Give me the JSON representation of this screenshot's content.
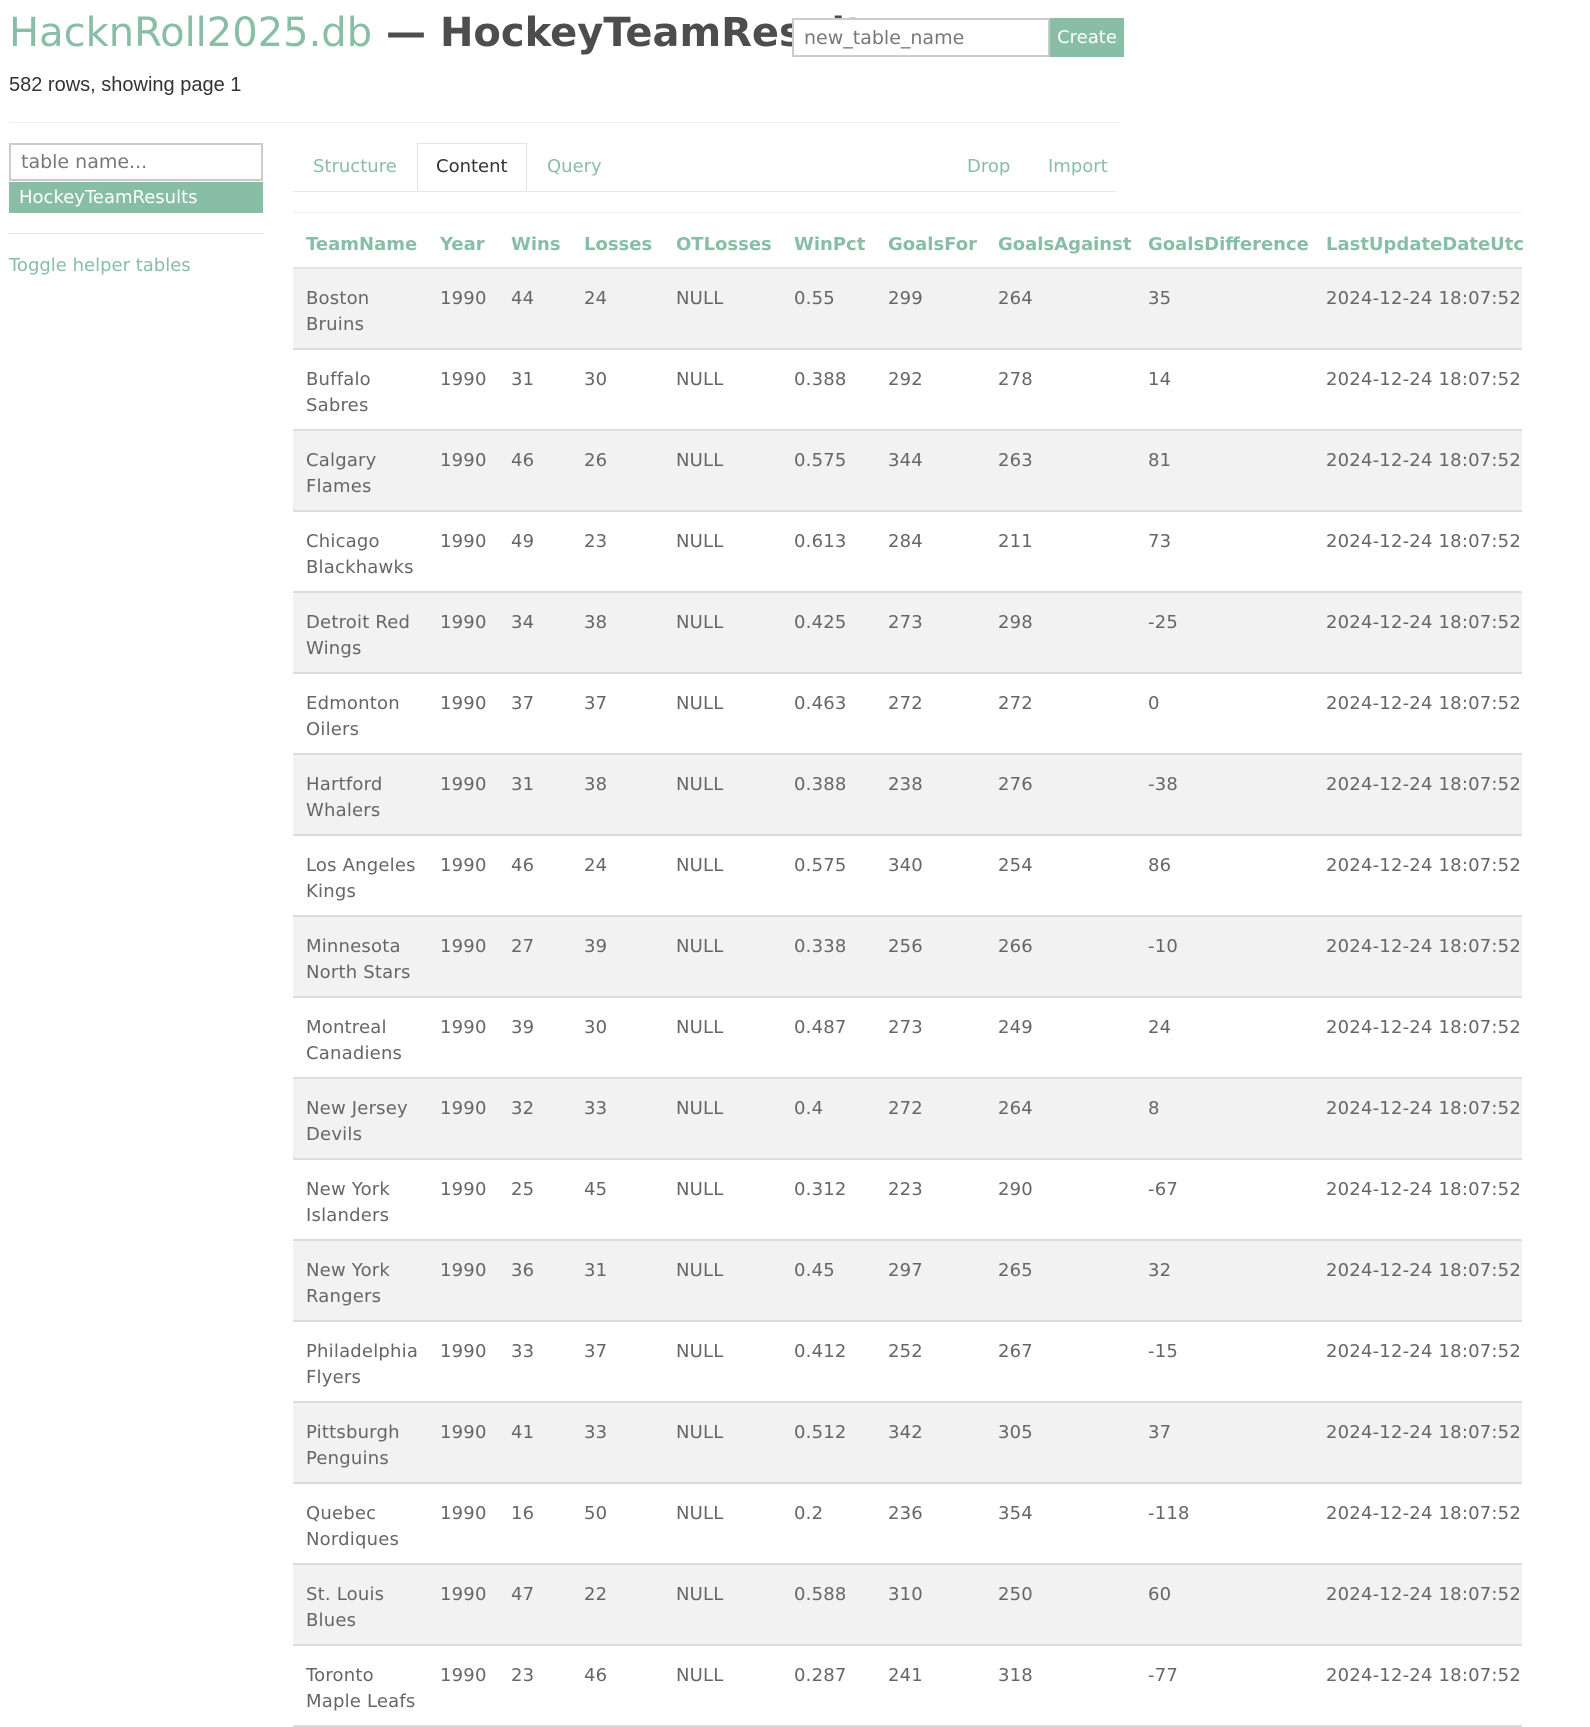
{
  "header": {
    "db_name": "HacknRoll2025.db",
    "separator_and_table": " — HockeyTeamResults",
    "new_table_placeholder": "new_table_name",
    "create_label": "Create",
    "subtitle": "582 rows, showing page 1"
  },
  "sidebar": {
    "search_placeholder": "table name...",
    "tables": [
      "HockeyTeamResults"
    ],
    "toggle_label": "Toggle helper tables"
  },
  "tabs": {
    "structure": "Structure",
    "content": "Content",
    "query": "Query",
    "drop": "Drop",
    "import": "Import",
    "active": "Content"
  },
  "table": {
    "columns": [
      "TeamName",
      "Year",
      "Wins",
      "Losses",
      "OTLosses",
      "WinPct",
      "GoalsFor",
      "GoalsAgainst",
      "GoalsDifference",
      "LastUpdateDateUtc"
    ],
    "rows": [
      [
        "Boston Bruins",
        "1990",
        "44",
        "24",
        "NULL",
        "0.55",
        "299",
        "264",
        "35",
        "2024-12-24 18:07:52"
      ],
      [
        "Buffalo Sabres",
        "1990",
        "31",
        "30",
        "NULL",
        "0.388",
        "292",
        "278",
        "14",
        "2024-12-24 18:07:52"
      ],
      [
        "Calgary Flames",
        "1990",
        "46",
        "26",
        "NULL",
        "0.575",
        "344",
        "263",
        "81",
        "2024-12-24 18:07:52"
      ],
      [
        "Chicago Blackhawks",
        "1990",
        "49",
        "23",
        "NULL",
        "0.613",
        "284",
        "211",
        "73",
        "2024-12-24 18:07:52"
      ],
      [
        "Detroit Red Wings",
        "1990",
        "34",
        "38",
        "NULL",
        "0.425",
        "273",
        "298",
        "-25",
        "2024-12-24 18:07:52"
      ],
      [
        "Edmonton Oilers",
        "1990",
        "37",
        "37",
        "NULL",
        "0.463",
        "272",
        "272",
        "0",
        "2024-12-24 18:07:52"
      ],
      [
        "Hartford Whalers",
        "1990",
        "31",
        "38",
        "NULL",
        "0.388",
        "238",
        "276",
        "-38",
        "2024-12-24 18:07:52"
      ],
      [
        "Los Angeles Kings",
        "1990",
        "46",
        "24",
        "NULL",
        "0.575",
        "340",
        "254",
        "86",
        "2024-12-24 18:07:52"
      ],
      [
        "Minnesota North Stars",
        "1990",
        "27",
        "39",
        "NULL",
        "0.338",
        "256",
        "266",
        "-10",
        "2024-12-24 18:07:52"
      ],
      [
        "Montreal Canadiens",
        "1990",
        "39",
        "30",
        "NULL",
        "0.487",
        "273",
        "249",
        "24",
        "2024-12-24 18:07:52"
      ],
      [
        "New Jersey Devils",
        "1990",
        "32",
        "33",
        "NULL",
        "0.4",
        "272",
        "264",
        "8",
        "2024-12-24 18:07:52"
      ],
      [
        "New York Islanders",
        "1990",
        "25",
        "45",
        "NULL",
        "0.312",
        "223",
        "290",
        "-67",
        "2024-12-24 18:07:52"
      ],
      [
        "New York Rangers",
        "1990",
        "36",
        "31",
        "NULL",
        "0.45",
        "297",
        "265",
        "32",
        "2024-12-24 18:07:52"
      ],
      [
        "Philadelphia Flyers",
        "1990",
        "33",
        "37",
        "NULL",
        "0.412",
        "252",
        "267",
        "-15",
        "2024-12-24 18:07:52"
      ],
      [
        "Pittsburgh Penguins",
        "1990",
        "41",
        "33",
        "NULL",
        "0.512",
        "342",
        "305",
        "37",
        "2024-12-24 18:07:52"
      ],
      [
        "Quebec Nordiques",
        "1990",
        "16",
        "50",
        "NULL",
        "0.2",
        "236",
        "354",
        "-118",
        "2024-12-24 18:07:52"
      ],
      [
        "St. Louis Blues",
        "1990",
        "47",
        "22",
        "NULL",
        "0.588",
        "310",
        "250",
        "60",
        "2024-12-24 18:07:52"
      ],
      [
        "Toronto Maple Leafs",
        "1990",
        "23",
        "46",
        "NULL",
        "0.287",
        "241",
        "318",
        "-77",
        "2024-12-24 18:07:52"
      ]
    ]
  },
  "colors": {
    "accent": "#88bda6",
    "title_text": "#4d4d4d",
    "row_stripe": "#f2f2f2"
  }
}
